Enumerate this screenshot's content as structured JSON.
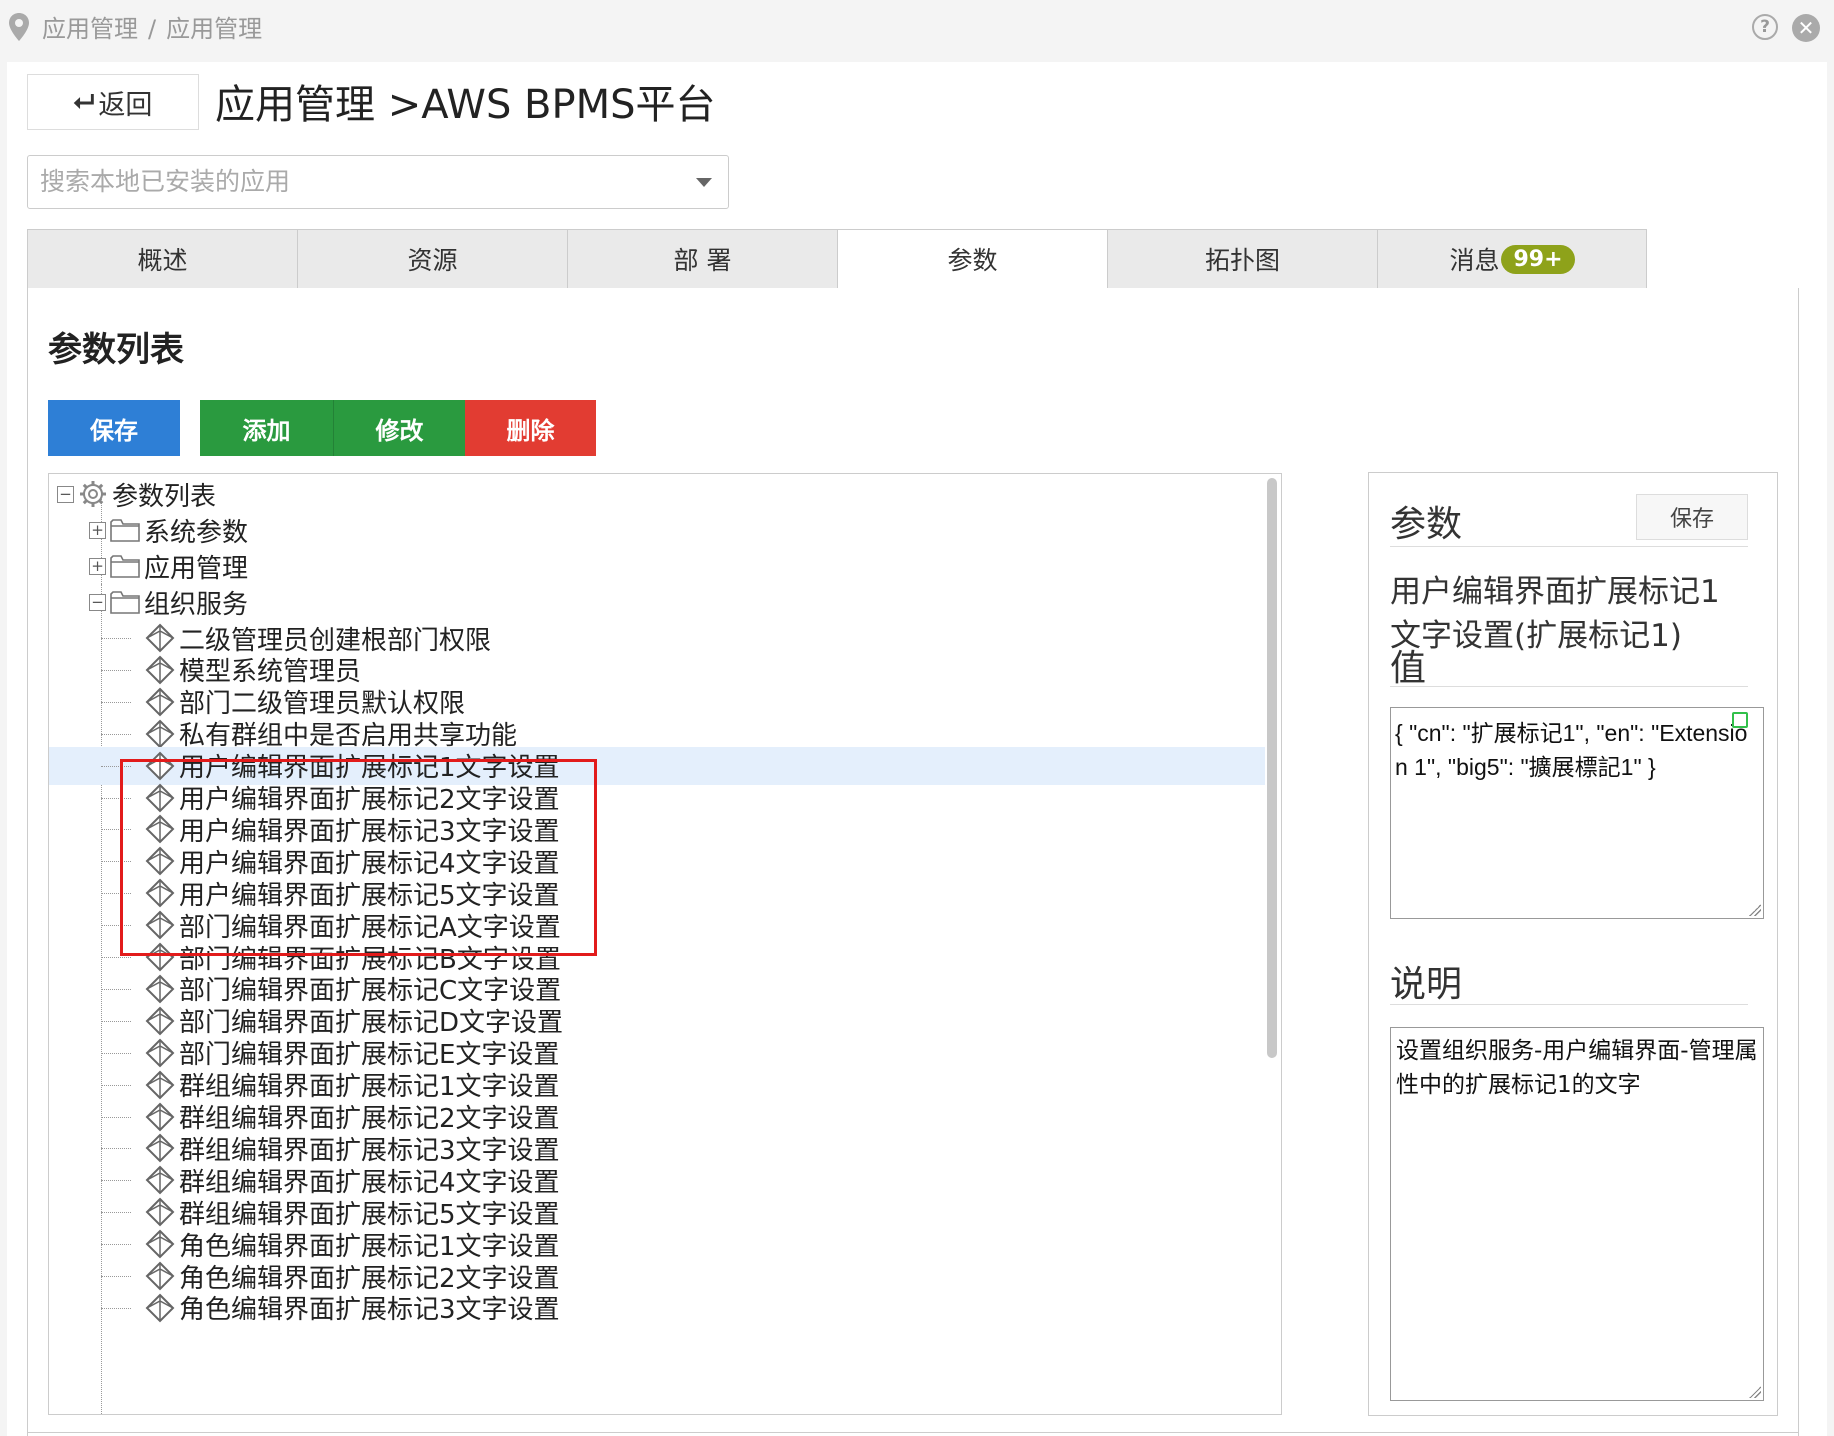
{
  "breadcrumb": {
    "items": [
      "应用管理",
      "应用管理"
    ],
    "separator": "/"
  },
  "header": {
    "back_label": "返回",
    "title": "应用管理 >AWS BPMS平台"
  },
  "search": {
    "placeholder": "搜索本地已安装的应用"
  },
  "tabs": [
    {
      "label": "概述",
      "active": false
    },
    {
      "label": "资源",
      "active": false
    },
    {
      "label": "部 署",
      "active": false
    },
    {
      "label": "参数",
      "active": true
    },
    {
      "label": "拓扑图",
      "active": false
    },
    {
      "label": "消息",
      "active": false,
      "badge": "99+"
    }
  ],
  "section": {
    "title": "参数列表"
  },
  "toolbar": {
    "save_label": "保存",
    "add_label": "添加",
    "edit_label": "修改",
    "delete_label": "删除"
  },
  "tree": {
    "root": "参数列表",
    "folders": [
      "系统参数",
      "应用管理",
      "组织服务"
    ],
    "leaves": [
      "二级管理员创建根部门权限",
      "模型系统管理员",
      "部门二级管理员默认权限",
      "私有群组中是否启用共享功能",
      "用户编辑界面扩展标记1文字设置",
      "用户编辑界面扩展标记2文字设置",
      "用户编辑界面扩展标记3文字设置",
      "用户编辑界面扩展标记4文字设置",
      "用户编辑界面扩展标记5文字设置",
      "部门编辑界面扩展标记A文字设置",
      "部门编辑界面扩展标记B文字设置",
      "部门编辑界面扩展标记C文字设置",
      "部门编辑界面扩展标记D文字设置",
      "部门编辑界面扩展标记E文字设置",
      "群组编辑界面扩展标记1文字设置",
      "群组编辑界面扩展标记2文字设置",
      "群组编辑界面扩展标记3文字设置",
      "群组编辑界面扩展标记4文字设置",
      "群组编辑界面扩展标记5文字设置",
      "角色编辑界面扩展标记1文字设置",
      "角色编辑界面扩展标记2文字设置",
      "角色编辑界面扩展标记3文字设置"
    ],
    "selected_index": 4
  },
  "side": {
    "title": "参数",
    "save_label": "保存",
    "name": "用户编辑界面扩展标记1文字设置(扩展标记1)",
    "value_label": "值",
    "value": "{ \"cn\": \"扩展标记1\", \"en\": \"Extension 1\", \"big5\": \"擴展標記1\" }",
    "desc_label": "说明",
    "desc": "设置组织服务-用户编辑界面-管理属性中的扩展标记1的文字"
  }
}
